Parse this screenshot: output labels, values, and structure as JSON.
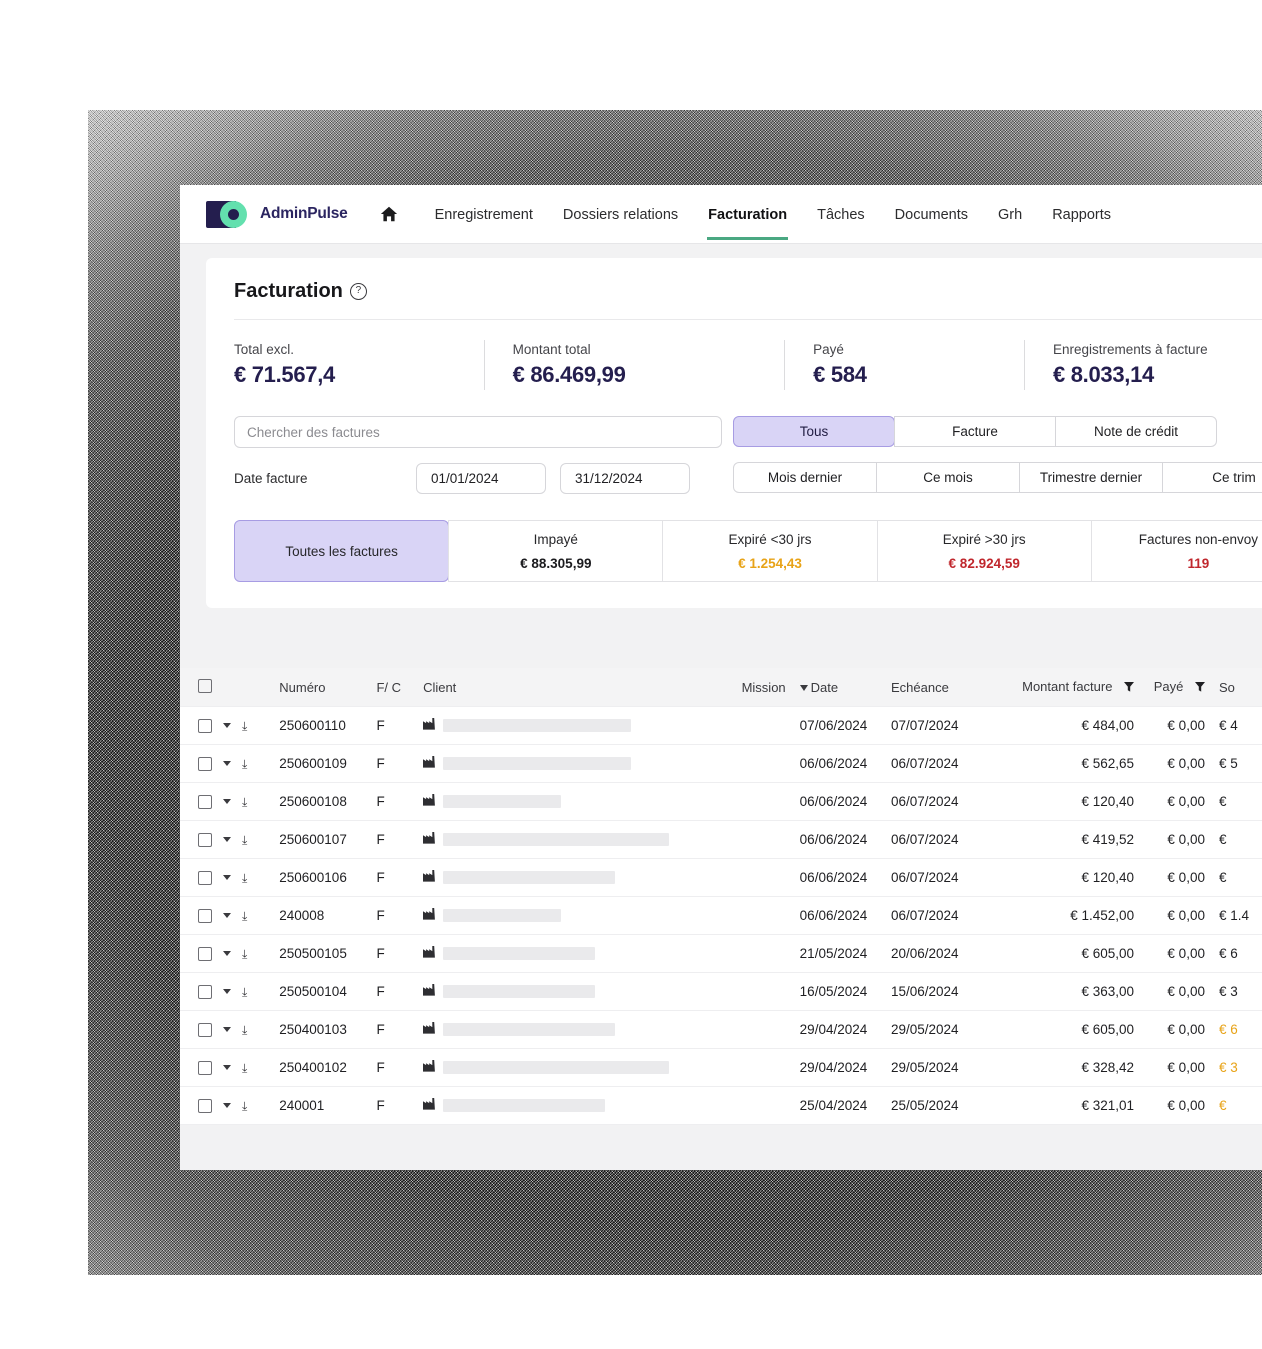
{
  "brand": {
    "name": "AdminPulse",
    "logo_colors": {
      "navy": "#241e4e",
      "mint": "#63e0ae"
    },
    "accent": "#4aa882"
  },
  "nav": {
    "home_icon": "home-icon",
    "items": [
      {
        "label": "Enregistrement",
        "active": false
      },
      {
        "label": "Dossiers relations",
        "active": false
      },
      {
        "label": "Facturation",
        "active": true
      },
      {
        "label": "Tâches",
        "active": false
      },
      {
        "label": "Documents",
        "active": false
      },
      {
        "label": "Grh",
        "active": false
      },
      {
        "label": "Rapports",
        "active": false
      }
    ]
  },
  "page": {
    "title": "Facturation",
    "help_icon": "question-mark-icon"
  },
  "kpis": [
    {
      "label": "Total excl.",
      "value": "€ 71.567,4"
    },
    {
      "label": "Montant total",
      "value": "€ 86.469,99"
    },
    {
      "label": "Payé",
      "value": "€ 584"
    },
    {
      "label": "Enregistrements à facture",
      "value": "€ 8.033,14"
    }
  ],
  "search": {
    "placeholder": "Chercher des factures",
    "value": ""
  },
  "date_filter": {
    "label": "Date facture",
    "from": "01/01/2024",
    "to": "31/12/2024"
  },
  "type_filter": {
    "options": [
      {
        "label": "Tous",
        "selected": true
      },
      {
        "label": "Facture",
        "selected": false
      },
      {
        "label": "Note de crédit",
        "selected": false
      }
    ]
  },
  "period_filter": {
    "options": [
      {
        "label": "Mois dernier",
        "selected": false
      },
      {
        "label": "Ce mois",
        "selected": false
      },
      {
        "label": "Trimestre dernier",
        "selected": false
      },
      {
        "label": "Ce trim",
        "selected": false
      }
    ]
  },
  "status_tabs": [
    {
      "label": "Toutes les factures",
      "value": "",
      "selected": true,
      "tone": "default"
    },
    {
      "label": "Impayé",
      "value": "€ 88.305,99",
      "selected": false,
      "tone": "default"
    },
    {
      "label": "Expiré <30 jrs",
      "value": "€ 1.254,43",
      "selected": false,
      "tone": "amber"
    },
    {
      "label": "Expiré >30 jrs",
      "value": "€ 82.924,59",
      "selected": false,
      "tone": "red"
    },
    {
      "label": "Factures non-envoy",
      "value": "119",
      "selected": false,
      "tone": "red"
    }
  ],
  "table": {
    "columns": {
      "select": "",
      "numero": "Numéro",
      "fc": "F/ C",
      "client": "Client",
      "mission": "Mission",
      "date": "Date",
      "echeance": "Echéance",
      "montant": "Montant facture",
      "paye": "Payé",
      "solde": "So"
    },
    "sort_column": "date",
    "sort_icon": "sort-descending-icon",
    "filter_icon": "filter-icon",
    "client_icon": "factory-icon",
    "rows": [
      {
        "numero": "250600110",
        "fc": "F",
        "client_width": 188,
        "mission": "",
        "date": "07/06/2024",
        "echeance": "07/07/2024",
        "montant": "€ 484,00",
        "paye": "€ 0,00",
        "solde": "€ 4",
        "solde_tone": "default"
      },
      {
        "numero": "250600109",
        "fc": "F",
        "client_width": 188,
        "mission": "",
        "date": "06/06/2024",
        "echeance": "06/07/2024",
        "montant": "€ 562,65",
        "paye": "€ 0,00",
        "solde": "€ 5",
        "solde_tone": "default"
      },
      {
        "numero": "250600108",
        "fc": "F",
        "client_width": 118,
        "mission": "",
        "date": "06/06/2024",
        "echeance": "06/07/2024",
        "montant": "€ 120,40",
        "paye": "€ 0,00",
        "solde": "€",
        "solde_tone": "default"
      },
      {
        "numero": "250600107",
        "fc": "F",
        "client_width": 226,
        "mission": "",
        "date": "06/06/2024",
        "echeance": "06/07/2024",
        "montant": "€ 419,52",
        "paye": "€ 0,00",
        "solde": "€",
        "solde_tone": "default"
      },
      {
        "numero": "250600106",
        "fc": "F",
        "client_width": 172,
        "mission": "",
        "date": "06/06/2024",
        "echeance": "06/07/2024",
        "montant": "€ 120,40",
        "paye": "€ 0,00",
        "solde": "€",
        "solde_tone": "default"
      },
      {
        "numero": "240008",
        "fc": "F",
        "client_width": 118,
        "mission": "",
        "date": "06/06/2024",
        "echeance": "06/07/2024",
        "montant": "€ 1.452,00",
        "paye": "€ 0,00",
        "solde": "€ 1.4",
        "solde_tone": "default"
      },
      {
        "numero": "250500105",
        "fc": "F",
        "client_width": 152,
        "mission": "",
        "date": "21/05/2024",
        "echeance": "20/06/2024",
        "montant": "€ 605,00",
        "paye": "€ 0,00",
        "solde": "€ 6",
        "solde_tone": "default"
      },
      {
        "numero": "250500104",
        "fc": "F",
        "client_width": 152,
        "mission": "",
        "date": "16/05/2024",
        "echeance": "15/06/2024",
        "montant": "€ 363,00",
        "paye": "€ 0,00",
        "solde": "€ 3",
        "solde_tone": "default"
      },
      {
        "numero": "250400103",
        "fc": "F",
        "client_width": 172,
        "mission": "",
        "date": "29/04/2024",
        "echeance": "29/05/2024",
        "montant": "€ 605,00",
        "paye": "€ 0,00",
        "solde": "€ 6",
        "solde_tone": "amber"
      },
      {
        "numero": "250400102",
        "fc": "F",
        "client_width": 226,
        "mission": "",
        "date": "29/04/2024",
        "echeance": "29/05/2024",
        "montant": "€ 328,42",
        "paye": "€ 0,00",
        "solde": "€ 3",
        "solde_tone": "amber"
      },
      {
        "numero": "240001",
        "fc": "F",
        "client_width": 162,
        "mission": "",
        "date": "25/04/2024",
        "echeance": "25/05/2024",
        "montant": "€ 321,01",
        "paye": "€ 0,00",
        "solde": "€",
        "solde_tone": "amber"
      }
    ]
  }
}
